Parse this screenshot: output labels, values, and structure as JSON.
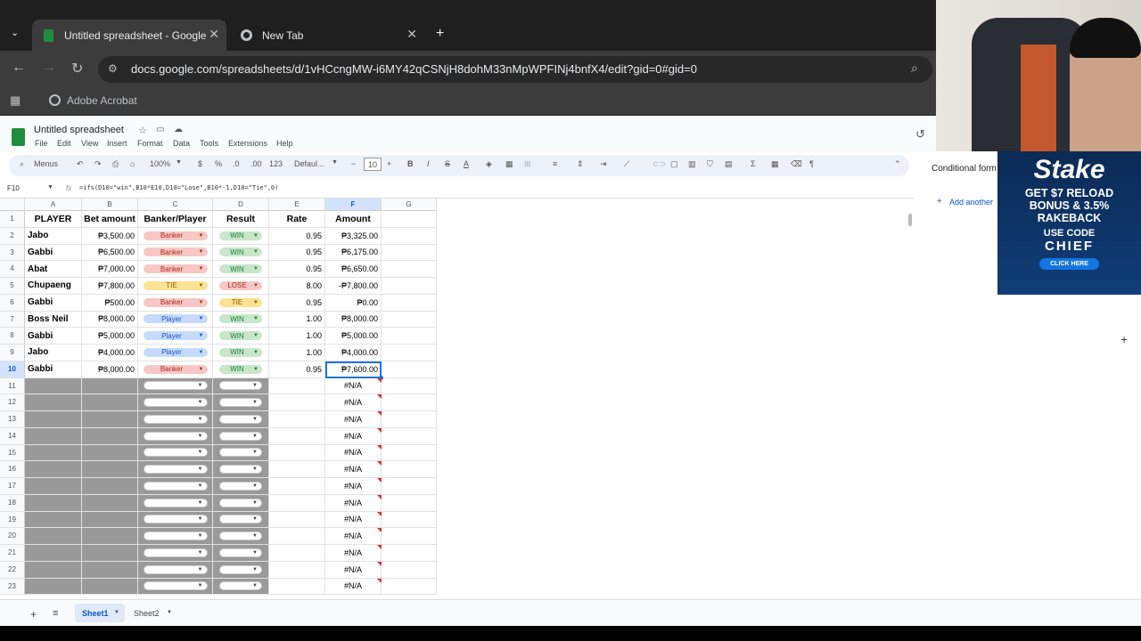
{
  "browser": {
    "tabs": [
      {
        "title": "Untitled spreadsheet - Google",
        "active": true
      },
      {
        "title": "New Tab",
        "active": false
      }
    ],
    "url": "docs.google.com/spreadsheets/d/1vHCcngMW-i6MY42qCSNjH8dohM33nMpWPFINj4bnfX4/edit?gid=0#gid=0",
    "bookmark": "Adobe Acrobat"
  },
  "sheets": {
    "doc_title": "Untitled spreadsheet",
    "menus": [
      "File",
      "Edit",
      "View",
      "Insert",
      "Format",
      "Data",
      "Tools",
      "Extensions",
      "Help"
    ],
    "toolbar": {
      "menus_label": "Menus",
      "zoom": "100%",
      "currency": "$",
      "percent": "%",
      "dec_dec": ".0",
      "dec_inc": ".00",
      "num_format": "123",
      "font": "Defaul...",
      "font_size": "10",
      "bold": "B",
      "italic": "I",
      "strike": "S",
      "text_color": "A"
    },
    "name_box": "F10",
    "formula": "=ifs(D10=\"win\",B10*E10,D10=\"Lose\",B10*-1,D10=\"Tie\",0)",
    "fx": "fx",
    "columns": [
      "A",
      "B",
      "C",
      "D",
      "E",
      "F",
      "G"
    ],
    "headers": [
      "PLAYER",
      "Bet amount",
      "Banker/Player",
      "Result",
      "Rate",
      "Amount"
    ],
    "rows": [
      {
        "player": "Jabo",
        "bet": "₱3,500.00",
        "bp": "Banker",
        "result": "WIN",
        "rate": "0.95",
        "amount": "₱3,325.00"
      },
      {
        "player": "Gabbi",
        "bet": "₱6,500.00",
        "bp": "Banker",
        "result": "WIN",
        "rate": "0.95",
        "amount": "₱6,175.00"
      },
      {
        "player": "Abat",
        "bet": "₱7,000.00",
        "bp": "Banker",
        "result": "WIN",
        "rate": "0.95",
        "amount": "₱6,650.00"
      },
      {
        "player": "Chupaeng",
        "bet": "₱7,800.00",
        "bp": "TIE",
        "result": "LOSE",
        "rate": "8.00",
        "amount": "-₱7,800.00"
      },
      {
        "player": "Gabbi",
        "bet": "₱500.00",
        "bp": "Banker",
        "result": "TIE",
        "rate": "0.95",
        "amount": "₱0.00"
      },
      {
        "player": "Boss Neil",
        "bet": "₱8,000.00",
        "bp": "Player",
        "result": "WIN",
        "rate": "1.00",
        "amount": "₱8,000.00"
      },
      {
        "player": "Gabbi",
        "bet": "₱5,000.00",
        "bp": "Player",
        "result": "WIN",
        "rate": "1.00",
        "amount": "₱5,000.00"
      },
      {
        "player": "Jabo",
        "bet": "₱4,000.00",
        "bp": "Player",
        "result": "WIN",
        "rate": "1.00",
        "amount": "₱4,000.00"
      },
      {
        "player": "Gabbi",
        "bet": "₱8,000.00",
        "bp": "Banker",
        "result": "WIN",
        "rate": "0.95",
        "amount": "₱7,600.00"
      }
    ],
    "na_value": "#N/A",
    "row_numbers": [
      "1",
      "2",
      "3",
      "4",
      "5",
      "6",
      "7",
      "8",
      "9",
      "10",
      "11",
      "12",
      "13",
      "14",
      "15",
      "16",
      "17",
      "18",
      "19",
      "20",
      "21",
      "22",
      "23"
    ],
    "sheet_tabs": [
      "Sheet1",
      "Sheet2"
    ]
  },
  "panel": {
    "title": "Conditional form",
    "add_another": "Add another"
  },
  "ad": {
    "brand": "Stake",
    "line1": "GET $7 RELOAD",
    "line2": "BONUS & 3.5%",
    "line3": "RAKEBACK",
    "line4": "USE CODE",
    "code": "CHIEF",
    "cta": "CLICK HERE"
  },
  "colors": {
    "banker": "#f7c7c5",
    "player": "#c6dafc",
    "tie": "#fde293",
    "win": "#c8e6c9",
    "selection": "#1a73e8"
  }
}
